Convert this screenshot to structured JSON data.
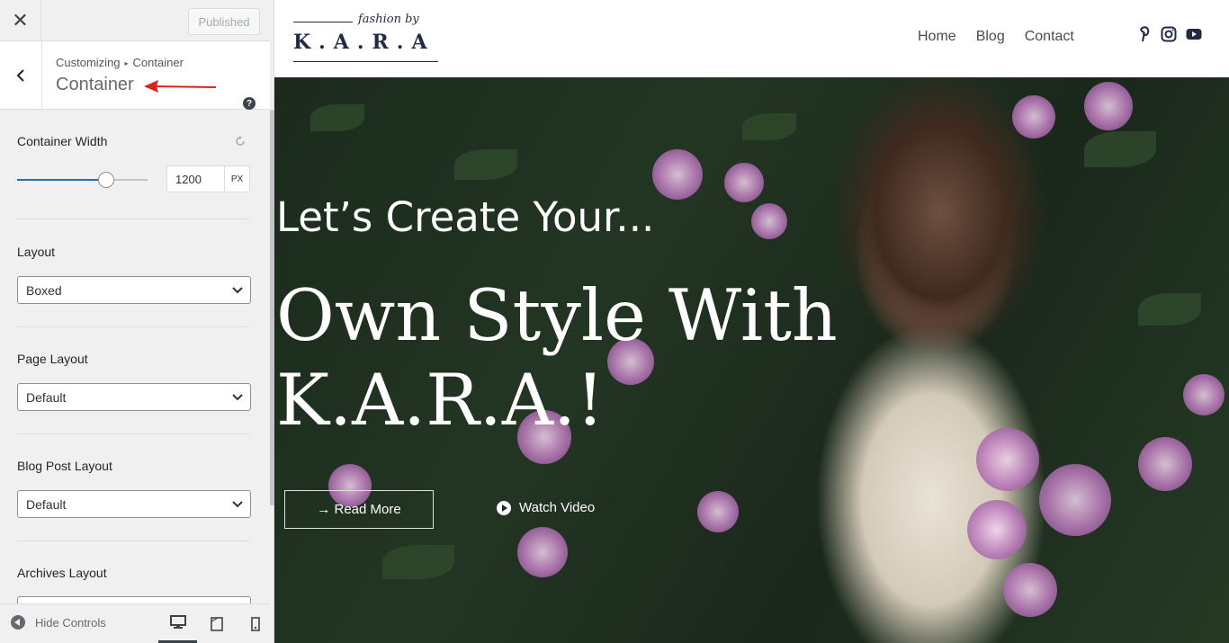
{
  "customizer": {
    "close_glyph": "✕",
    "published_label": "Published",
    "breadcrumb_root": "Customizing",
    "breadcrumb_sep": "▸",
    "breadcrumb_current": "Container",
    "section_title": "Container",
    "help_glyph": "?",
    "controls": {
      "container_width": {
        "label": "Container Width",
        "value": "1200",
        "unit": "PX",
        "slider_fraction": 0.68
      },
      "layout": {
        "label": "Layout",
        "selected": "Boxed"
      },
      "page_layout": {
        "label": "Page Layout",
        "selected": "Default"
      },
      "blog_post_layout": {
        "label": "Blog Post Layout",
        "selected": "Default"
      },
      "archives_layout": {
        "label": "Archives Layout"
      }
    },
    "footer": {
      "hide_controls_label": "Hide Controls",
      "devices": [
        "desktop-icon",
        "tablet-icon",
        "mobile-icon"
      ]
    }
  },
  "site": {
    "logo": {
      "script": "fashion by",
      "brand": "K.A.R.A"
    },
    "nav": [
      "Home",
      "Blog",
      "Contact"
    ],
    "social": [
      "pinterest-icon",
      "instagram-icon",
      "youtube-icon"
    ],
    "hero": {
      "line1": "Let’s Create Your...",
      "line2a": "Own Style With",
      "line2b": "K.A.R.A.!",
      "read_more": "→ Read More",
      "watch_video": "Watch Video"
    }
  },
  "colors": {
    "accent": "#2271b1",
    "annotation_arrow": "#e0201b",
    "brand_navy": "#1f2a44"
  }
}
